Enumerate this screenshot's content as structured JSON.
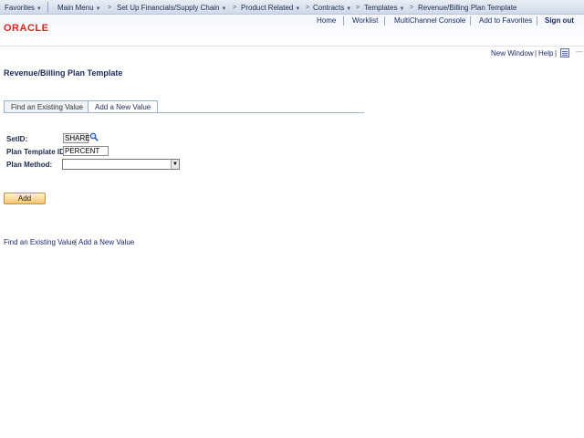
{
  "topnav": {
    "favorites": "Favorites",
    "main_menu": "Main Menu",
    "breadcrumbs": [
      "Set Up Financials/Supply Chain",
      "Product Related",
      "Contracts",
      "Templates",
      "Revenue/Billing Plan Template"
    ],
    "dropdown_glyph": "▼",
    "arrow_glyph": ">"
  },
  "header": {
    "logo": "ORACLE",
    "links": [
      "Home",
      "Worklist",
      "MultiChannel Console",
      "Add to Favorites"
    ],
    "sign_out": "Sign out",
    "logo_color": "#e2231a"
  },
  "utility": {
    "new_window": "New Window",
    "separator": "|",
    "help": "Help",
    "dash": "—"
  },
  "page": {
    "title": "Revenue/Billing Plan Template",
    "tabs": [
      "Find an Existing Value",
      "Add a New Value"
    ],
    "active_tab": "Add a New Value"
  },
  "form": {
    "setid_label": "SetID:",
    "setid_value": "SHARE",
    "template_label": "Plan Template ID:",
    "template_value": "PERCENT",
    "method_label": "Plan Method:",
    "method_value": ""
  },
  "actions": {
    "add_label": "Add"
  },
  "footer_links": {
    "find": "Find an Existing Value",
    "separator": "|",
    "add": "Add a New Value"
  }
}
